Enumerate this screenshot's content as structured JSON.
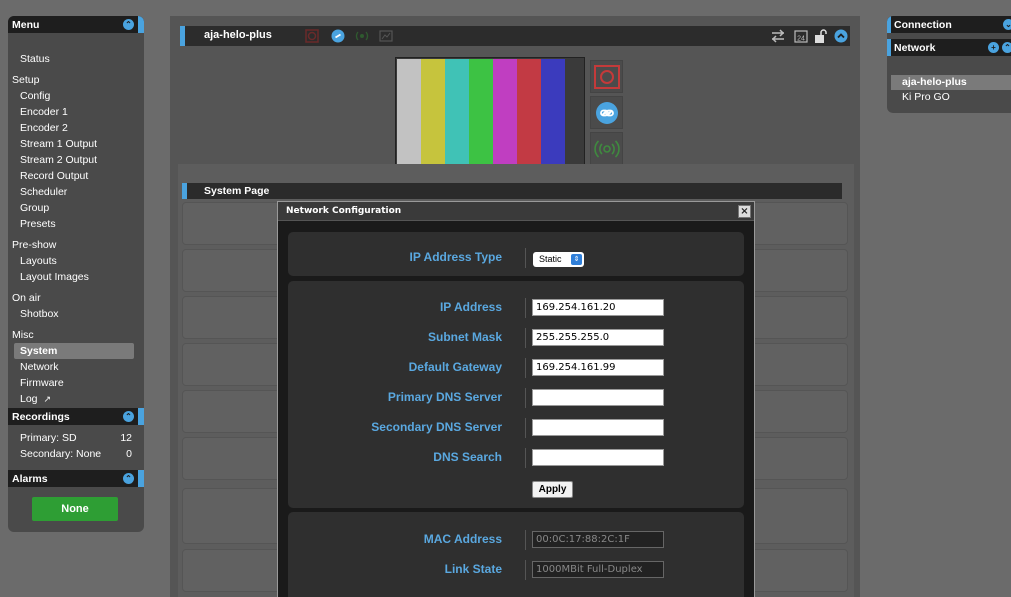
{
  "menu": {
    "title": "Menu",
    "items": [
      {
        "label": "Status",
        "kind": "item"
      },
      {
        "label": "Setup",
        "kind": "section"
      },
      {
        "label": "Config",
        "kind": "item"
      },
      {
        "label": "Encoder 1",
        "kind": "item"
      },
      {
        "label": "Encoder 2",
        "kind": "item"
      },
      {
        "label": "Stream 1 Output",
        "kind": "item"
      },
      {
        "label": "Stream 2 Output",
        "kind": "item"
      },
      {
        "label": "Record Output",
        "kind": "item"
      },
      {
        "label": "Scheduler",
        "kind": "item"
      },
      {
        "label": "Group",
        "kind": "item"
      },
      {
        "label": "Presets",
        "kind": "item"
      },
      {
        "label": "Pre-show",
        "kind": "section"
      },
      {
        "label": "Layouts",
        "kind": "item"
      },
      {
        "label": "Layout Images",
        "kind": "item"
      },
      {
        "label": "On air",
        "kind": "section"
      },
      {
        "label": "Shotbox",
        "kind": "item"
      },
      {
        "label": "Misc",
        "kind": "section"
      },
      {
        "label": "System",
        "kind": "item",
        "selected": true
      },
      {
        "label": "Network",
        "kind": "item"
      },
      {
        "label": "Firmware",
        "kind": "item"
      },
      {
        "label": "Log",
        "kind": "item",
        "icon": "external-link-icon"
      }
    ]
  },
  "recordings": {
    "title": "Recordings",
    "rows": [
      {
        "label": "Primary: SD",
        "value": "12"
      },
      {
        "label": "Secondary: None",
        "value": "0"
      }
    ]
  },
  "alarms": {
    "title": "Alarms",
    "button_label": "None",
    "button_color": "#2e9e34"
  },
  "device": {
    "name": "aja-helo-plus",
    "toolbar_icons": [
      "record-icon",
      "stream-icon",
      "broadcast-icon",
      "monitor-icon",
      "settings-sliders-icon",
      "calendar-24-icon",
      "unlock-icon",
      "collapse-icon"
    ],
    "calendar_number": "24",
    "color_bars": [
      "#c2c2c2",
      "#c6c43d",
      "#40c2b6",
      "#3dc244",
      "#c03ec1",
      "#c23a44",
      "#3b3bbd"
    ]
  },
  "system_page": {
    "title": "System Page"
  },
  "dialog": {
    "title": "Network Configuration",
    "close_icon": "close-icon",
    "ip_type": {
      "label": "IP Address Type",
      "value": "Static"
    },
    "fields": [
      {
        "label": "IP Address",
        "value": "169.254.161.20"
      },
      {
        "label": "Subnet Mask",
        "value": "255.255.255.0"
      },
      {
        "label": "Default Gateway",
        "value": "169.254.161.99"
      },
      {
        "label": "Primary DNS Server",
        "value": ""
      },
      {
        "label": "Secondary DNS Server",
        "value": ""
      },
      {
        "label": "DNS Search",
        "value": ""
      }
    ],
    "apply_label": "Apply",
    "info": [
      {
        "label": "MAC Address",
        "value": "00:0C:17:88:2C:1F"
      },
      {
        "label": "Link State",
        "value": "1000MBit Full-Duplex"
      }
    ]
  },
  "right_panel": {
    "connection_title": "Connection",
    "network_title": "Network",
    "devices": [
      {
        "label": "aja-helo-plus",
        "selected": true
      },
      {
        "label": "Ki Pro GO",
        "selected": false
      }
    ]
  },
  "colors": {
    "accent": "#4aa3df",
    "label_blue": "#5aa8e0",
    "record_red": "#c43a3a",
    "stream_blue": "#4aa3df",
    "broadcast_green": "#3f8a3f"
  }
}
